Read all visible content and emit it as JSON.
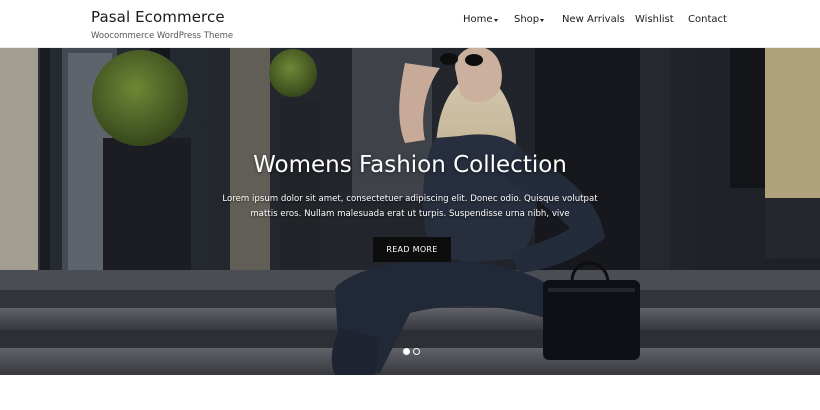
{
  "site": {
    "title": "Pasal Ecommerce",
    "tagline": "Woocommerce WordPress Theme"
  },
  "nav": {
    "items": [
      {
        "label": "Home",
        "has_dropdown": true
      },
      {
        "label": "Shop",
        "has_dropdown": true
      },
      {
        "label": "New Arrivals",
        "has_dropdown": false
      },
      {
        "label": "Wishlist",
        "has_dropdown": false
      },
      {
        "label": "Contact",
        "has_dropdown": false
      }
    ]
  },
  "hero": {
    "title": "Womens Fashion Collection",
    "description": "Lorem ipsum dolor sit amet, consectetuer adipiscing elit. Donec odio. Quisque volutpat mattis eros. Nullam malesuada erat ut turpis. Suspendisse urna nibh, vive",
    "button_label": "READ MORE",
    "slider": {
      "count": 2,
      "active_index": 0
    }
  },
  "colors": {
    "button_bg": "#0d0d0d",
    "header_bg": "#ffffff",
    "text_dark": "#1a1a1a"
  }
}
